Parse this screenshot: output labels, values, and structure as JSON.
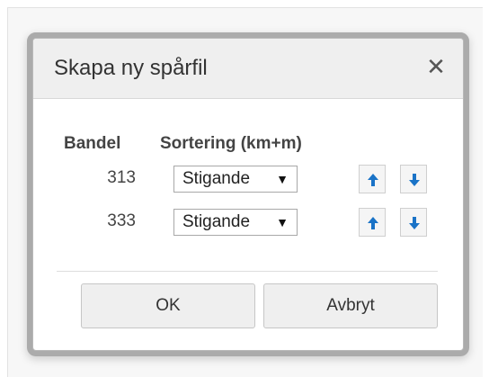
{
  "dialog": {
    "title": "Skapa ny spårfil",
    "close_symbol": "✕",
    "close_icon": "close-icon"
  },
  "columns": {
    "bandel": "Bandel",
    "sortering": "Sortering (km+m)"
  },
  "rows": [
    {
      "bandel": "313",
      "sortering": "Stigande",
      "up_icon": "arrow-up-icon",
      "down_icon": "arrow-down-icon"
    },
    {
      "bandel": "333",
      "sortering": "Stigande",
      "up_icon": "arrow-up-icon",
      "down_icon": "arrow-down-icon"
    }
  ],
  "buttons": {
    "ok": "OK",
    "cancel": "Avbryt"
  },
  "colors": {
    "arrow_accent": "#1a73c7",
    "header_bg": "#efefef",
    "button_bg": "#efefef"
  }
}
